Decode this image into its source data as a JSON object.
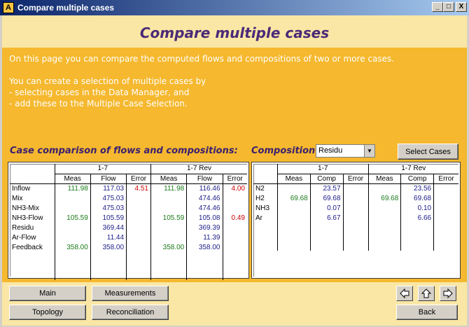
{
  "window": {
    "title": "Compare multiple cases",
    "controls": [
      "_",
      "□",
      "X"
    ]
  },
  "header": {
    "title": "Compare multiple cases"
  },
  "description": "On this page you can compare the computed flows and compositions of two or more cases.\n\nYou can create a selection of multiple cases by\n- selecting cases in the Data Manager, and\n- add these to the Multiple Case Selection.",
  "flows_section": {
    "title": "Case comparison of flows and compositions:",
    "groups": [
      "1-7",
      "1-7 Rev"
    ],
    "columns": [
      "Meas",
      "Flow",
      "Error",
      "Meas",
      "Flow",
      "Error"
    ],
    "rows": [
      {
        "name": "Inflow",
        "cells": [
          "111.98",
          "117.03",
          "4.51",
          "111.98",
          "116.46",
          "4.00"
        ]
      },
      {
        "name": "Mix",
        "cells": [
          "",
          "475.03",
          "",
          "",
          "474.46",
          ""
        ]
      },
      {
        "name": "NH3-Mix",
        "cells": [
          "",
          "475.03",
          "",
          "",
          "474.46",
          ""
        ]
      },
      {
        "name": "NH3-Flow",
        "cells": [
          "105.59",
          "105.59",
          "",
          "105.59",
          "105.08",
          "0.49"
        ]
      },
      {
        "name": "Residu",
        "cells": [
          "",
          "369.44",
          "",
          "",
          "369.39",
          ""
        ]
      },
      {
        "name": "Ar-Flow",
        "cells": [
          "",
          "11.44",
          "",
          "",
          "11.39",
          ""
        ]
      },
      {
        "name": "Feedback",
        "cells": [
          "358.00",
          "358.00",
          "",
          "358.00",
          "358.00",
          ""
        ]
      }
    ]
  },
  "composition_section": {
    "title": "Composition",
    "selected": "Residu",
    "select_cases_label": "Select Cases",
    "groups": [
      "1-7",
      "1-7 Rev"
    ],
    "columns": [
      "Meas",
      "Comp",
      "Error",
      "Meas",
      "Comp",
      "Error"
    ],
    "rows": [
      {
        "name": "N2",
        "cells": [
          "",
          "23.57",
          "",
          "",
          "23.56",
          ""
        ]
      },
      {
        "name": "H2",
        "cells": [
          "69.68",
          "69.68",
          "",
          "69.68",
          "69.68",
          ""
        ]
      },
      {
        "name": "NH3",
        "cells": [
          "",
          "0.07",
          "",
          "",
          "0.10",
          ""
        ]
      },
      {
        "name": "Ar",
        "cells": [
          "",
          "6.67",
          "",
          "",
          "6.66",
          ""
        ]
      }
    ]
  },
  "footer": {
    "main_label": "Main",
    "measurements_label": "Measurements",
    "topology_label": "Topology",
    "reconciliation_label": "Reconciliation",
    "back_label": "Back"
  },
  "colors": {
    "meas": "#1a7a1a",
    "value": "#1c1c88",
    "error": "#cc0000",
    "title": "#4b2a78"
  }
}
